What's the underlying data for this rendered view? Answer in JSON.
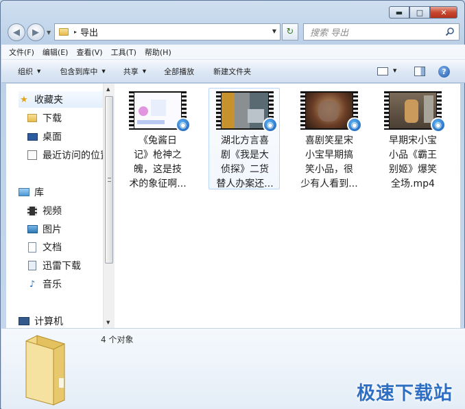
{
  "window": {
    "minimize": "▬",
    "maximize": "□",
    "close": "✕"
  },
  "nav": {
    "back_icon": "◀",
    "forward_icon": "▶",
    "dropdown": "▼"
  },
  "address": {
    "separator": "▸",
    "crumb": "导出",
    "dropdown": "▼",
    "refresh": "↻"
  },
  "search": {
    "placeholder": "搜索 导出"
  },
  "menu": [
    "文件(F)",
    "编辑(E)",
    "查看(V)",
    "工具(T)",
    "帮助(H)"
  ],
  "commands": [
    {
      "label": "组织",
      "arrow": "▼"
    },
    {
      "label": "包含到库中",
      "arrow": "▼"
    },
    {
      "label": "共享",
      "arrow": "▼"
    },
    {
      "label": "全部播放",
      "arrow": ""
    },
    {
      "label": "新建文件夹",
      "arrow": ""
    }
  ],
  "view_arrow": "▼",
  "help": "?",
  "sidebar": {
    "favorites": "收藏夹",
    "downloads": "下载",
    "desktop": "桌面",
    "recent": "最近访问的位置",
    "library": "库",
    "videos": "视频",
    "pictures": "图片",
    "documents": "文档",
    "xunlei": "迅雷下载",
    "music": "音乐",
    "computer": "计算机",
    "music_icon": "♪",
    "star_icon": "★"
  },
  "scroll": {
    "up": "▲",
    "down": "▼"
  },
  "files": [
    {
      "lines": [
        "《兔酱日",
        "记》枪神之",
        "魄，这是技",
        "术的象征啊..."
      ]
    },
    {
      "lines": [
        "湖北方言喜",
        "剧《我是大",
        "侦探》二货",
        "替人办案还..."
      ]
    },
    {
      "lines": [
        "喜剧笑星宋",
        "小宝早期搞",
        "笑小品，很",
        "少有人看到..."
      ]
    },
    {
      "lines": [
        "早期宋小宝",
        "小品《霸王",
        "别姬》爆笑",
        "全场.mp4"
      ]
    }
  ],
  "badge_icon": "◉",
  "status": {
    "count": "4 个对象"
  },
  "watermark": "极速下载站",
  "colors": {
    "accent": "#2e6fc4",
    "selection": "#b8d6fb",
    "close": "#c8472f"
  }
}
